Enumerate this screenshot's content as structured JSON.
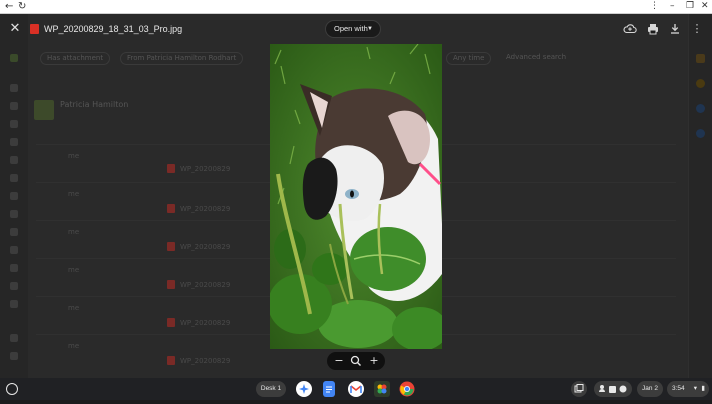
{
  "browser": {
    "back_icon": "arrow-left",
    "reload_icon": "reload",
    "menu_icon": "vertical-dots",
    "minimize_icon": "minimize",
    "restore_icon": "restore",
    "close_icon": "close"
  },
  "viewer": {
    "file_name": "WP_20200829_18_31_03_Pro.jpg",
    "open_with_label": "Open with",
    "actions": [
      "add-to-drive",
      "print",
      "download",
      "more"
    ]
  },
  "background": {
    "chips": [
      "Has attachment",
      "From Patricia Hamilton Rodhart",
      "Any time",
      "Advanced search"
    ],
    "sender": "Patricia Hamilton",
    "rows": [
      {
        "who": "me",
        "file": "WP_20200829"
      },
      {
        "who": "me",
        "file": "WP_20200829"
      },
      {
        "who": "me",
        "file": "WP_20200829"
      },
      {
        "who": "me",
        "file": "WP_20200829"
      },
      {
        "who": "me",
        "file": "WP_20200829"
      },
      {
        "who": "me",
        "file": "WP_20200829"
      }
    ]
  },
  "zoom": {
    "zoom_out": "−",
    "zoom_in": "+"
  },
  "shelf": {
    "desk_label": "Desk 1",
    "date": "Jan 2",
    "time": "3:54",
    "apps": [
      "assistant",
      "docs",
      "gmail",
      "photos",
      "chrome"
    ]
  },
  "colors": {
    "shelf_bg": "#202124",
    "viewer_bg": "#1c1c1c",
    "file_icon": "#d93025"
  }
}
